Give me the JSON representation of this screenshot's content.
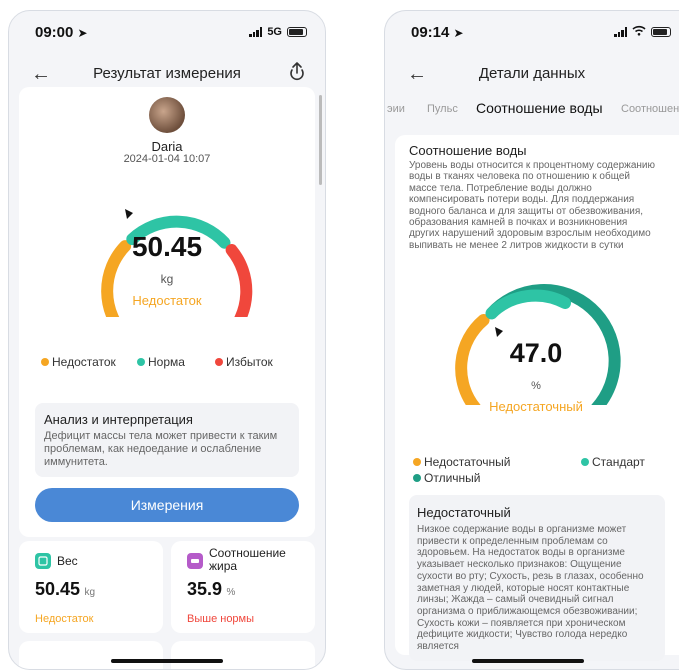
{
  "colors": {
    "orange": "#f5a623",
    "teal": "#2ec4a5",
    "teal_dark": "#1f9e85",
    "red": "#f0473c",
    "button": "#4a88d6"
  },
  "left": {
    "time": "09:00",
    "network": "5G",
    "title": "Результат измерения",
    "user_name": "Daria",
    "date": "2024-01-04 10:07",
    "gauge_value": "50.45",
    "gauge_unit": "kg",
    "gauge_status": "Недостаток",
    "legend": [
      "Недостаток",
      "Норма",
      "Избыток"
    ],
    "analysis_title": "Анализ и интерпретация",
    "analysis_text": "Дефицит массы тела может привести к таким проблемам, как недоедание и ослабление иммунитета.",
    "button": "Измерения",
    "cards": [
      {
        "label": "Вес",
        "value": "50.45",
        "unit": "kg",
        "status": "Недостаток"
      },
      {
        "label": "Соотношение жира",
        "value": "35.9",
        "unit": "%",
        "status": "Выше  нормы"
      }
    ]
  },
  "right": {
    "time": "09:14",
    "title": "Детали данных",
    "tabs": [
      "эии",
      "Пульс",
      "Соотношение воды",
      "Соотношен"
    ],
    "section_title": "Соотношение воды",
    "description": "Уровень воды относится к процентному содержанию воды в тканях человека по отношению к общей массе тела. Потребление воды должно компенсировать потери воды. Для поддержания водного баланса и для защиты от обезвоживания, образования камней в почках и возникновения других нарушений здоровым взрослым необходимо выпивать не менее 2 литров жидкости в сутки",
    "gauge_value": "47.0",
    "gauge_unit": "%",
    "gauge_status": "Недостаточный",
    "legend": [
      "Недостаточный",
      "Стандарт",
      "Отличный"
    ],
    "info_title": "Недостаточный",
    "info_text": "Низкое содержание воды в организме может привести к  определенным проблемам со здоровьем. На недостаток воды в организме указывает несколько признаков: Ощущение сухости во рту; Сухость, резь в глазах, особенно заметная у людей, которые носят контактные линзы; Жажда – самый очевидный сигнал организма о приближающемся обезвоживании; Сухость кожи – появляется при хроническом дефиците жидкости; Чувство голода нередко является"
  }
}
